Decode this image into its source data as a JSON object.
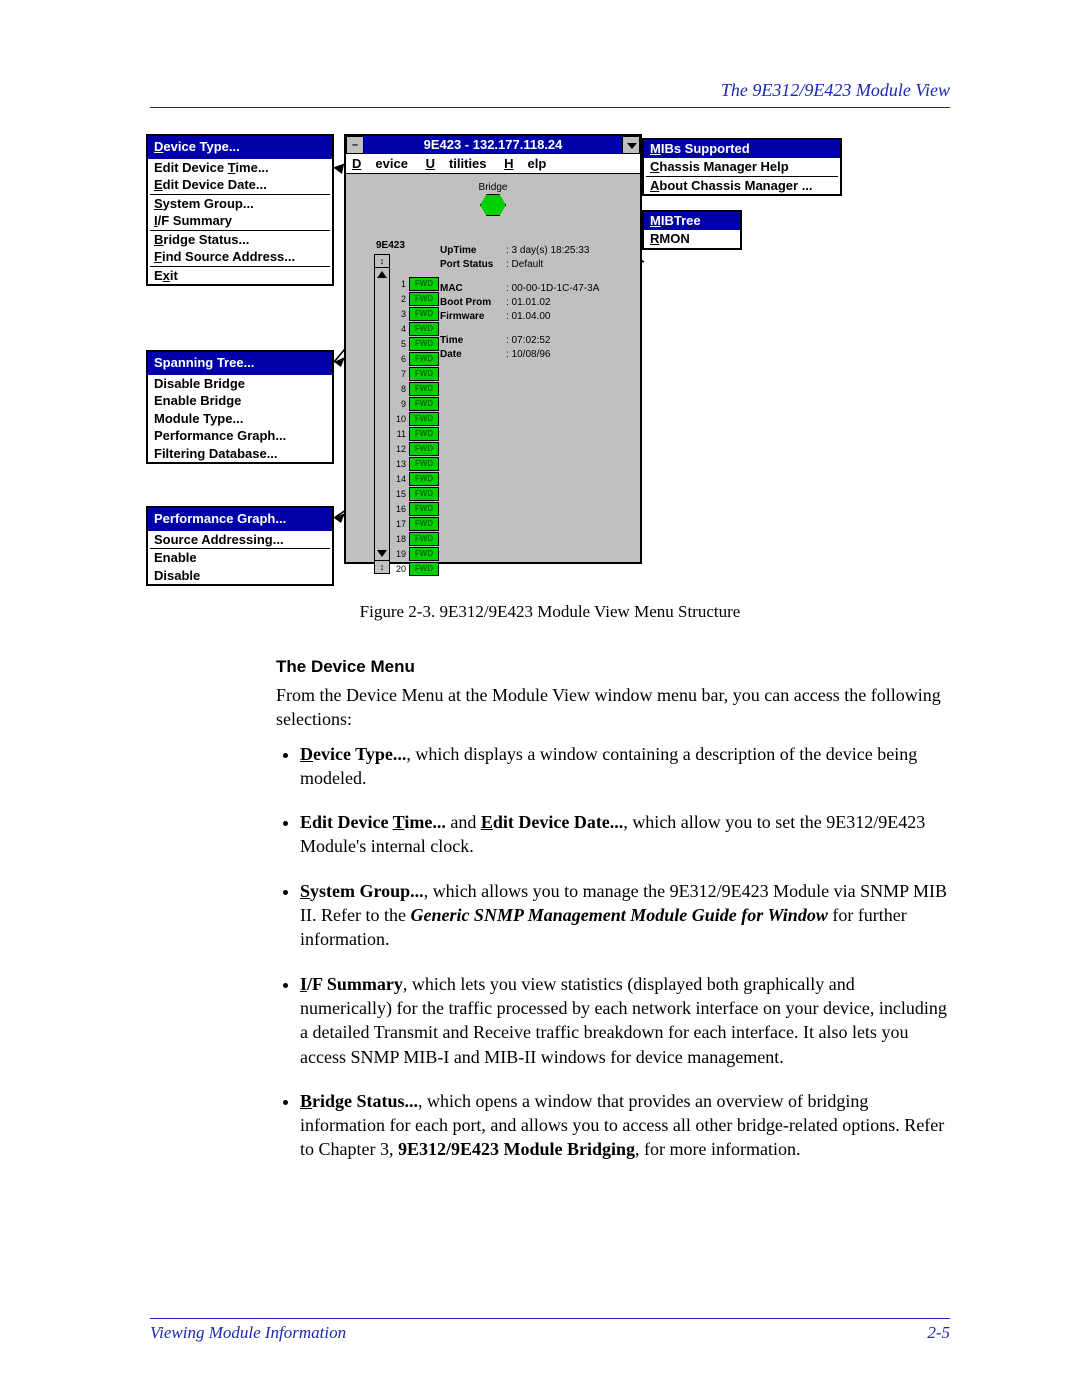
{
  "header": "The 9E312/9E423 Module View",
  "caption": "Figure 2-3.  9E312/9E423 Module View Menu Structure",
  "footer_left": "Viewing Module Information",
  "footer_right": "2-5",
  "device_menu": {
    "header": "Device Type...",
    "items": [
      "Edit Device Time...",
      "Edit Device Date...",
      "System Group...",
      "I/F Summary",
      "Bridge Status...",
      "Find Source Address...",
      "Exit"
    ]
  },
  "spanning_menu": {
    "header": "Spanning Tree...",
    "items": [
      "Disable Bridge",
      "Enable Bridge",
      "Module Type...",
      "Performance Graph...",
      "Filtering Database..."
    ]
  },
  "perf_menu": {
    "header": "Performance Graph...",
    "items": [
      "Source Addressing...",
      "Enable",
      "Disable"
    ]
  },
  "help_menu": {
    "header": "MIBs Supported",
    "items": [
      "Chassis Manager Help",
      "About Chassis Manager ..."
    ]
  },
  "util_menu": {
    "header": "MIBTree",
    "items": [
      "RMON"
    ]
  },
  "module_window": {
    "title": "9E423 - 132.177.118.24",
    "menubar": {
      "device": "Device",
      "utilities": "Utilities",
      "help": "Help"
    },
    "bridge_label": "Bridge",
    "module_label": "9E423",
    "port_label": "FWD",
    "port_count": 20,
    "info": {
      "uptime_k": "UpTime",
      "uptime_v": ": 3 day(s) 18:25:33",
      "pstat_k": "Port Status",
      "pstat_v": ": Default",
      "mac_k": "MAC",
      "mac_v": ": 00-00-1D-1C-47-3A",
      "boot_k": "Boot Prom",
      "boot_v": ": 01.01.02",
      "fw_k": "Firmware",
      "fw_v": ": 01.04.00",
      "time_k": "Time",
      "time_v": ": 07:02:52",
      "date_k": "Date",
      "date_v": ": 10/08/96"
    }
  },
  "body": {
    "heading": "The Device Menu",
    "intro": "From the Device Menu at the Module View window menu bar, you can access the following selections:",
    "b1_lead": "Device Type...",
    "b1_rest": ", which displays a window containing a description of the device being modeled.",
    "b2_a": "Edit Device Time...",
    "b2_mid": " and ",
    "b2_b": "Edit Device Date...",
    "b2_rest": ", which allow you to set the 9E312/9E423 Module's internal clock.",
    "b3_lead": "System Group...",
    "b3_rest_a": ", which allows you to manage the 9E312/9E423 Module via SNMP MIB II. Refer to the ",
    "b3_ref": "Generic SNMP Management Module Guide for Window",
    "b3_rest_b": " for further information.",
    "b4_lead": "I/F Summary",
    "b4_rest": ", which lets you view statistics (displayed both graphically and numerically) for the traffic processed by each network interface on your device, including a detailed Transmit and Receive traffic breakdown for each interface. It also lets you access SNMP MIB-I and MIB-II windows for device management.",
    "b5_lead": "Bridge Status...",
    "b5_rest_a": ", which opens a window that provides an overview of bridging information for each port, and allows you to access all other bridge-related options. Refer to Chapter 3, ",
    "b5_ref": "9E312/9E423 Module Bridging",
    "b5_rest_b": ", for more information."
  }
}
